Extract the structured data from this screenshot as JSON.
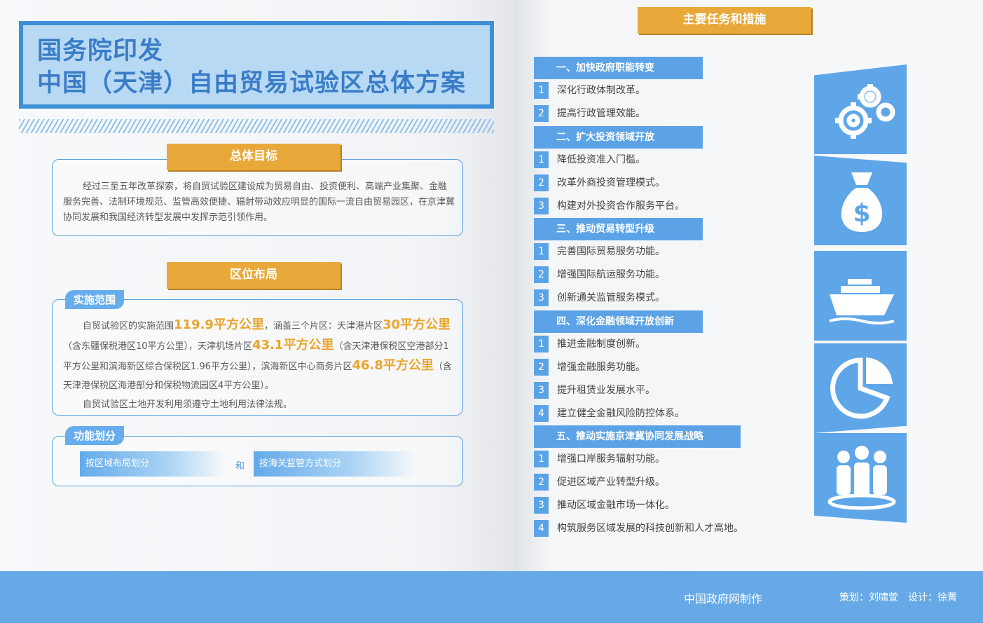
{
  "header": {
    "line1": "国务院印发",
    "line2": "中国（天津）自由贸易试验区总体方案"
  },
  "goal": {
    "title": "总体目标",
    "text": "经过三至五年改革探索，将自贸试验区建设成为贸易自由、投资便利、高端产业集聚、金融服务完善、法制环境规范、监管高效便捷、辐射带动效应明显的国际一流自由贸易园区，在京津冀协同发展和我国经济转型发展中发挥示范引领作用。"
  },
  "layout": {
    "title": "区位布局",
    "scope_tag": "实施范围",
    "scope": {
      "p1": "自贸试验区的实施范围",
      "v1": "119.9平方公里",
      "p2": "，涵盖三个片区：天津港片区",
      "v2": "30平方公里",
      "p3": "（含东疆保税港区10平方公里），天津机场片区",
      "v3": "43.1平方公里",
      "p4": "（含天津港保税区空港部分1平方公里和滨海新区综合保税区1.96平方公里），滨海新区中心商务片区",
      "v4": "46.8平方公里",
      "p5": "（含天津港保税区海港部分和保税物流园区4平方公里）。",
      "p6": "自贸试验区土地开发利用须遵守土地利用法律法规。"
    },
    "function_tag": "功能划分",
    "btn1": "按区域布局划分",
    "and": "和",
    "btn2": "按海关监管方式划分"
  },
  "tasks": {
    "title": "主要任务和措施",
    "sections": [
      {
        "label": "一、加快政府职能转变",
        "items": [
          "深化行政体制改革。",
          "提高行政管理效能。"
        ]
      },
      {
        "label": "二、扩大投资领域开放",
        "items": [
          "降低投资准入门槛。",
          "改革外商投资管理模式。",
          "构建对外投资合作服务平台。"
        ]
      },
      {
        "label": "三、推动贸易转型升级",
        "items": [
          "完善国际贸易服务功能。",
          "增强国际航运服务功能。",
          "创新通关监管服务模式。"
        ]
      },
      {
        "label": "四、深化金融领域开放创新",
        "items": [
          "推进金融制度创新。",
          "增强金融服务功能。",
          "提升租赁业发展水平。",
          "建立健全金融风险防控体系。"
        ]
      },
      {
        "label": "五、推动实施京津冀协同发展战略",
        "items": [
          "增强口岸服务辐射功能。",
          "促进区域产业转型升级。",
          "推动区域金融市场一体化。",
          "构筑服务区域发展的科技创新和人才高地。"
        ]
      }
    ],
    "numbers": [
      "1",
      "2",
      "3",
      "4"
    ]
  },
  "icons": [
    "gears-icon",
    "money-bag-icon",
    "ship-icon",
    "pie-chart-icon",
    "people-icon"
  ],
  "footer": {
    "left": "中国政府网制作",
    "right": "策划：刘啸萱　设计：徐菁"
  },
  "colors": {
    "blue": "#5ba3e6",
    "gold": "#e8a93a",
    "title_blue": "#3a7dc6"
  }
}
